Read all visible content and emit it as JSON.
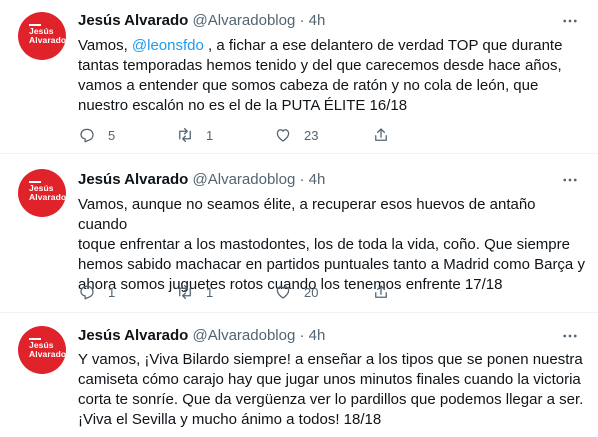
{
  "tweets": [
    {
      "author": "Jesús Alvarado",
      "handle": "@Alvaradoblog",
      "separator": "·",
      "time": "4h",
      "avatar_text": "Jesús Alvarado",
      "text_before": "Vamos, ",
      "mention": "@leonsfdo",
      "text_after": " , a fichar a ese delantero de verdad TOP que durante\ntantas temporadas hemos tenido y del que carecemos desde hace años,\nvamos a entender que somos cabeza de ratón y no cola de león, que\nnuestro escalón no es el de la PUTA ÉLITE 16/18",
      "replies": "5",
      "retweets": "1",
      "likes": "23"
    },
    {
      "author": "Jesús Alvarado",
      "handle": "@Alvaradoblog",
      "separator": "·",
      "time": "4h",
      "avatar_text": "Jesús Alvarado",
      "text": "Vamos, aunque no seamos élite, a recuperar esos huevos de antaño cuando\ntoque enfrentar a los mastodontes, los de toda la vida, coño. Que siempre\nhemos sabido machacar en partidos puntuales tanto a Madrid como Barça y\nahora somos juguetes rotos cuando los tenemos enfrente 17/18",
      "replies": "1",
      "retweets": "1",
      "likes": "20"
    },
    {
      "author": "Jesús Alvarado",
      "handle": "@Alvaradoblog",
      "separator": "·",
      "time": "4h",
      "avatar_text": "Jesús Alvarado",
      "text": "Y vamos, ¡Viva Bilardo siempre! a enseñar a los tipos que se ponen nuestra\ncamiseta cómo carajo hay que jugar unos minutos finales cuando la victoria\ncorta te sonríe. Que da vergüenza ver lo pardillos que podemos llegar a ser.\n¡Viva el Sevilla y mucho ánimo a todos! 18/18"
    }
  ],
  "colors": {
    "avatar_bg": "#e0232b",
    "mention": "#1d9bf0",
    "muted": "#536471",
    "divider": "#eff3f4"
  },
  "icons": [
    "reply-icon",
    "retweet-icon",
    "like-icon",
    "share-icon",
    "more-options-icon"
  ]
}
